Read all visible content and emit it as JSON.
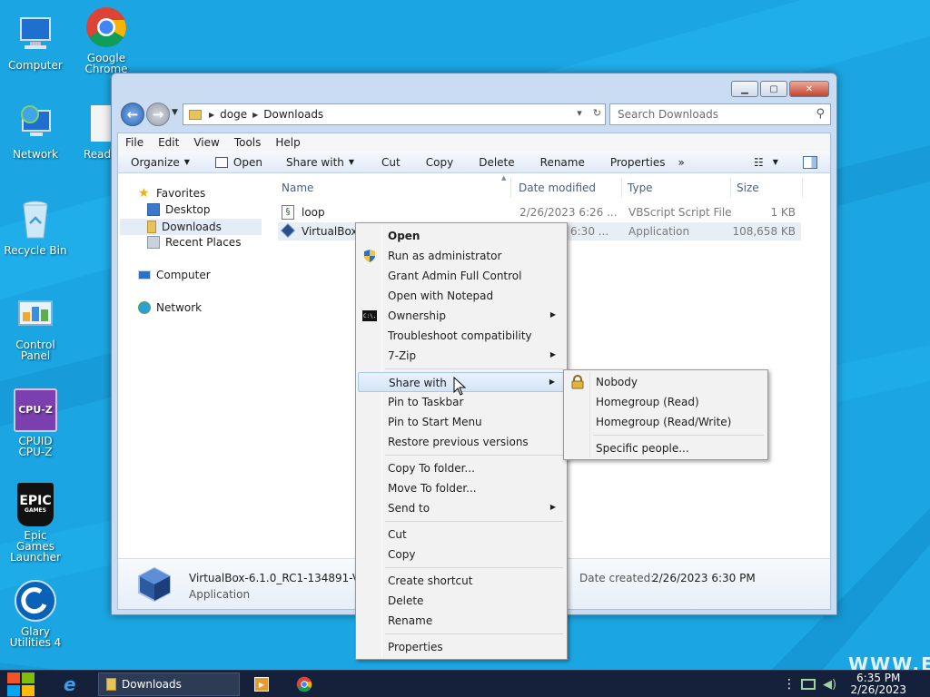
{
  "desktop": {
    "icons": [
      {
        "label": "Computer"
      },
      {
        "label": "Google Chrome"
      },
      {
        "label": "Network"
      },
      {
        "label": "Read"
      },
      {
        "label": "Recycle Bin"
      },
      {
        "label": "Control Panel"
      },
      {
        "label": "CPUID CPU-Z"
      },
      {
        "label": "Epic Games Launcher"
      },
      {
        "label": "Glary Utilities 4"
      }
    ],
    "cpuz_glyph": "CPU-Z",
    "epic_glyph": "EPIC",
    "epic_sub": "GAMES",
    "watermark": "WWW.EP"
  },
  "explorer": {
    "breadcrumbs": [
      "doge",
      "Downloads"
    ],
    "search_placeholder": "Search Downloads",
    "menu": [
      "File",
      "Edit",
      "View",
      "Tools",
      "Help"
    ],
    "toolbar": [
      "Organize",
      "Open",
      "Share with",
      "Cut",
      "Copy",
      "Delete",
      "Rename",
      "Properties"
    ],
    "toolbar_more": "»",
    "nav": {
      "favorites": "Favorites",
      "desktop": "Desktop",
      "downloads": "Downloads",
      "recent": "Recent Places",
      "computer": "Computer",
      "network": "Network"
    },
    "columns": [
      "Name",
      "Date modified",
      "Type",
      "Size"
    ],
    "files": [
      {
        "name": "loop",
        "date": "2/26/2023 6:26 ...",
        "type": "VBScript Script File",
        "size": "1 KB"
      },
      {
        "name": "VirtualBox-6",
        "date": "6:30 ...",
        "type": "Application",
        "size": "108,658 KB"
      }
    ],
    "details": {
      "name": "VirtualBox-6.1.0_RC1-134891-V",
      "type": "Application",
      "created_label": "Date created:",
      "created_value": "2/26/2023 6:30 PM"
    }
  },
  "context_menu": {
    "items": [
      {
        "label": "Open"
      },
      {
        "label": "Run as administrator"
      },
      {
        "label": "Grant Admin Full Control"
      },
      {
        "label": "Open with Notepad"
      },
      {
        "label": "Ownership"
      },
      {
        "label": "Troubleshoot compatibility"
      },
      {
        "label": "7-Zip"
      },
      {
        "label": "Share with"
      },
      {
        "label": "Pin to Taskbar"
      },
      {
        "label": "Pin to Start Menu"
      },
      {
        "label": "Restore previous versions"
      },
      {
        "label": "Copy To folder..."
      },
      {
        "label": "Move To folder..."
      },
      {
        "label": "Send to"
      },
      {
        "label": "Cut"
      },
      {
        "label": "Copy"
      },
      {
        "label": "Create shortcut"
      },
      {
        "label": "Delete"
      },
      {
        "label": "Rename"
      },
      {
        "label": "Properties"
      }
    ],
    "ownership_icon_text": "C:\\."
  },
  "share_submenu": {
    "items": [
      "Nobody",
      "Homegroup (Read)",
      "Homegroup (Read/Write)",
      "Specific people..."
    ]
  },
  "taskbar": {
    "downloads_label": "Downloads",
    "time": "6:35 PM",
    "date": "2/26/2023"
  },
  "colors": {
    "desktop": "#1aa3e0",
    "taskbar": "#15213a",
    "highlight": "#d4e4f6"
  }
}
